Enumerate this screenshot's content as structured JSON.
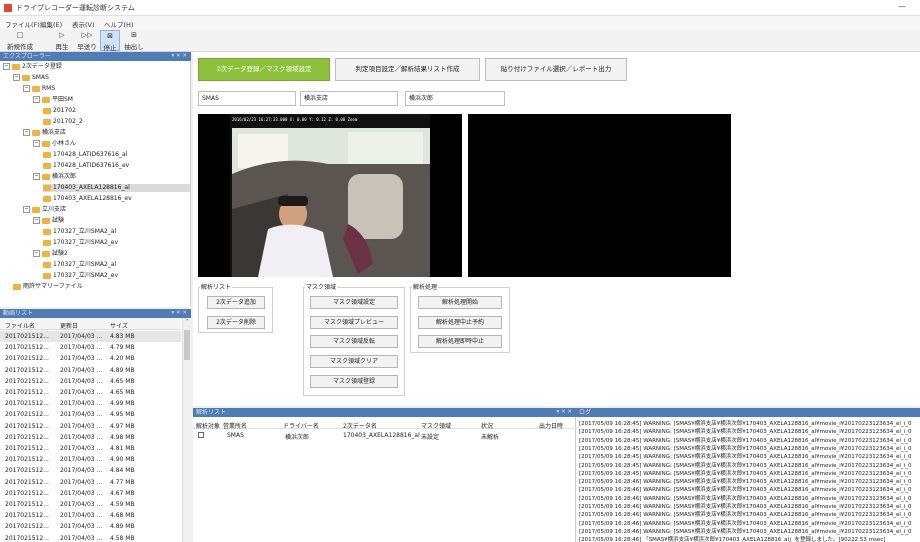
{
  "app": {
    "title": "ドライブレコーダー運転診断システム",
    "minimize": "—"
  },
  "menu": [
    "ファイル(F)",
    "編集(E)",
    "表示(V)",
    "ヘルプ(H)"
  ],
  "toolbar": [
    {
      "label": "新規作成",
      "icon": "□",
      "icon_name": "new-file-icon"
    },
    {
      "label": "再生",
      "icon": "▷",
      "icon_name": "play-icon"
    },
    {
      "label": "早送り",
      "icon": "▷▷",
      "icon_name": "fast-forward-icon"
    },
    {
      "label": "停止",
      "icon": "⊠",
      "icon_name": "stop-icon"
    },
    {
      "label": "抽出し",
      "icon": "⊞",
      "icon_name": "extract-icon"
    }
  ],
  "explorer": {
    "title": "エクスプローラー",
    "pins": "▾ ✕ ✕",
    "nodes": [
      {
        "label": "2次データ登録",
        "level": 0,
        "toggle": "⊟"
      },
      {
        "label": "SMAS",
        "level": 1,
        "toggle": "⊟"
      },
      {
        "label": "RMS",
        "level": 2,
        "toggle": "⊟"
      },
      {
        "label": "平田SM",
        "level": 3,
        "toggle": "⊟"
      },
      {
        "label": "201702",
        "level": 4,
        "toggle": ""
      },
      {
        "label": "201702_2",
        "level": 4,
        "toggle": ""
      },
      {
        "label": "横浜支店",
        "level": 2,
        "toggle": "⊟"
      },
      {
        "label": "小林さん",
        "level": 3,
        "toggle": "⊟"
      },
      {
        "label": "170428_LATID637616_al",
        "level": 4,
        "toggle": ""
      },
      {
        "label": "170428_LATID637616_ev",
        "level": 4,
        "toggle": ""
      },
      {
        "label": "横浜次郎",
        "level": 3,
        "toggle": "⊟"
      },
      {
        "label": "170403_AXELA128816_al",
        "level": 4,
        "toggle": "",
        "selected": true
      },
      {
        "label": "170403_AXELA128816_ev",
        "level": 4,
        "toggle": ""
      },
      {
        "label": "立川支店",
        "level": 2,
        "toggle": "⊟"
      },
      {
        "label": "試験",
        "level": 3,
        "toggle": "⊟"
      },
      {
        "label": "170327_立川SMA2_al",
        "level": 4,
        "toggle": ""
      },
      {
        "label": "170327_立川SMA2_ev",
        "level": 4,
        "toggle": ""
      },
      {
        "label": "試験2",
        "level": 3,
        "toggle": "⊟"
      },
      {
        "label": "170327_立川SMA2_al",
        "level": 4,
        "toggle": ""
      },
      {
        "label": "170327_立川SMA2_ev",
        "level": 4,
        "toggle": ""
      },
      {
        "label": "雨許サマリーファイル",
        "level": 1,
        "toggle": ""
      }
    ]
  },
  "videolist": {
    "title": "動画リスト",
    "pins": "▾ ✕ ✕",
    "columns": [
      "ファイル名",
      "更新日",
      "サイズ"
    ],
    "rows": [
      [
        "2017021512...",
        "2017/04/03 ...",
        "4.83 MB"
      ],
      [
        "2017021512...",
        "2017/04/03 ...",
        "4.79 MB"
      ],
      [
        "2017021512...",
        "2017/04/03 ...",
        "4.20 MB"
      ],
      [
        "2017021512...",
        "2017/04/03 ...",
        "4.89 MB"
      ],
      [
        "2017021512...",
        "2017/04/03 ...",
        "4.65 MB"
      ],
      [
        "2017021512...",
        "2017/04/03 ...",
        "4.65 MB"
      ],
      [
        "2017021512...",
        "2017/04/03 ...",
        "4.99 MB"
      ],
      [
        "2017021512...",
        "2017/04/03 ...",
        "4.95 MB"
      ],
      [
        "2017021512...",
        "2017/04/03 ...",
        "4.97 MB"
      ],
      [
        "2017021512...",
        "2017/04/03 ...",
        "4.98 MB"
      ],
      [
        "2017021512...",
        "2017/04/03 ...",
        "4.81 MB"
      ],
      [
        "2017021512...",
        "2017/04/03 ...",
        "4.90 MB"
      ],
      [
        "2017021512...",
        "2017/04/03 ...",
        "4.84 MB"
      ],
      [
        "2017021512...",
        "2017/04/03 ...",
        "4.77 MB"
      ],
      [
        "2017021512...",
        "2017/04/03 ...",
        "4.67 MB"
      ],
      [
        "2017021512...",
        "2017/04/03 ...",
        "4.59 MB"
      ],
      [
        "2017021512...",
        "2017/04/03 ...",
        "4.68 MB"
      ],
      [
        "2017021512...",
        "2017/04/03 ...",
        "4.89 MB"
      ],
      [
        "2017021512...",
        "2017/04/03 ...",
        "4.58 MB"
      ]
    ]
  },
  "tabs": [
    {
      "label": "2次データ登録／マスク領域設定",
      "active": true
    },
    {
      "label": "判定項目設定／解析結果リスト作成",
      "active": false
    },
    {
      "label": "貼り付けファイル選択／レポート出力",
      "active": false
    }
  ],
  "fields": [
    "SMAS",
    "横浜支店",
    "横浜次郎"
  ],
  "video": {
    "overlay": "2016/02/23 16:27:33.000   X: 0.00  Y: 0.12  Z: 0.00   Zoom"
  },
  "groups": {
    "analysis_list": {
      "label": "解析リスト",
      "buttons": [
        "2次データ追加",
        "2次データ削除"
      ]
    },
    "mask": {
      "label": "マスク領域",
      "buttons": [
        "マスク領域設定",
        "マスク領域プレビュー",
        "マスク領域反転",
        "マスク領域クリア",
        "マスク領域登録"
      ]
    },
    "process": {
      "label": "解析処理",
      "buttons": [
        "解析処理開始",
        "解析処理中止予約",
        "解析処理即時中止"
      ]
    }
  },
  "analysis_table": {
    "title": "解析リスト",
    "pins": "▾ ✕ ✕",
    "columns": [
      "解析対象",
      "営業所名",
      "ドライバー名",
      "2次データ名",
      "マスク領域",
      "状況",
      "出力日時"
    ],
    "rows": [
      [
        "",
        "SMAS",
        "横浜次郎",
        "170403_AXELA128816_al",
        "未設定",
        "未解析",
        ""
      ]
    ]
  },
  "log": {
    "title": "ログ",
    "lines": [
      "[2017/05/09 16:28:45] WARNING: [SMAS¥横浜支店¥横浜次郎¥170403_AXELA128816_al¥movie_i¥20170223123634_el_i_0",
      "[2017/05/09 16:28:45] WARNING: [SMAS¥横浜支店¥横浜次郎¥170403_AXELA128816_al¥movie_i¥20170223123634_el_i_0",
      "[2017/05/09 16:28:45] WARNING: [SMAS¥横浜支店¥横浜次郎¥170403_AXELA128816_al¥movie_i¥20170223123634_el_i_0",
      "[2017/05/09 16:28:45] WARNING: [SMAS¥横浜支店¥横浜次郎¥170403_AXELA128816_al¥movie_i¥20170223123634_el_i_0",
      "[2017/05/09 16:28:45] WARNING: [SMAS¥横浜支店¥横浜次郎¥170403_AXELA128816_al¥movie_i¥20170223123634_el_i_0",
      "[2017/05/09 16:28:45] WARNING: [SMAS¥横浜支店¥横浜次郎¥170403_AXELA128816_al¥movie_i¥20170223123634_el_i_0",
      "[2017/05/09 16:28:45] WARNING: [SMAS¥横浜支店¥横浜次郎¥170403_AXELA128816_al¥movie_i¥20170223123634_el_i_0",
      "[2017/05/09 16:28:46] WARNING: [SMAS¥横浜支店¥横浜次郎¥170403_AXELA128816_al¥movie_i¥20170223123634_el_i_0",
      "[2017/05/09 16:28:46] WARNING: [SMAS¥横浜支店¥横浜次郎¥170403_AXELA128816_al¥movie_i¥20170223123634_el_i_0",
      "[2017/05/09 16:28:46] WARNING: [SMAS¥横浜支店¥横浜次郎¥170403_AXELA128816_al¥movie_i¥20170223123634_el_i_0",
      "[2017/05/09 16:28:46] WARNING: [SMAS¥横浜支店¥横浜次郎¥170403_AXELA128816_al¥movie_i¥20170223123634_el_i_0",
      "[2017/05/09 16:28:46] WARNING: [SMAS¥横浜支店¥横浜次郎¥170403_AXELA128816_al¥movie_i¥20170223123634_el_i_0",
      "[2017/05/09 16:28:46] WARNING: [SMAS¥横浜支店¥横浜次郎¥170403_AXELA128816_al¥movie_i¥20170223123634_el_i_0",
      "[2017/05/09 16:28:46] WARNING: [SMAS¥横浜支店¥横浜次郎¥170403_AXELA128816_al¥movie_i¥20170223123634_el_i_0",
      "[2017/05/09 16:28:46] 「SMAS¥横浜支店¥横浜次郎¥170403_AXELA128816_al」を登録しました。[90222.53 msec]"
    ]
  }
}
